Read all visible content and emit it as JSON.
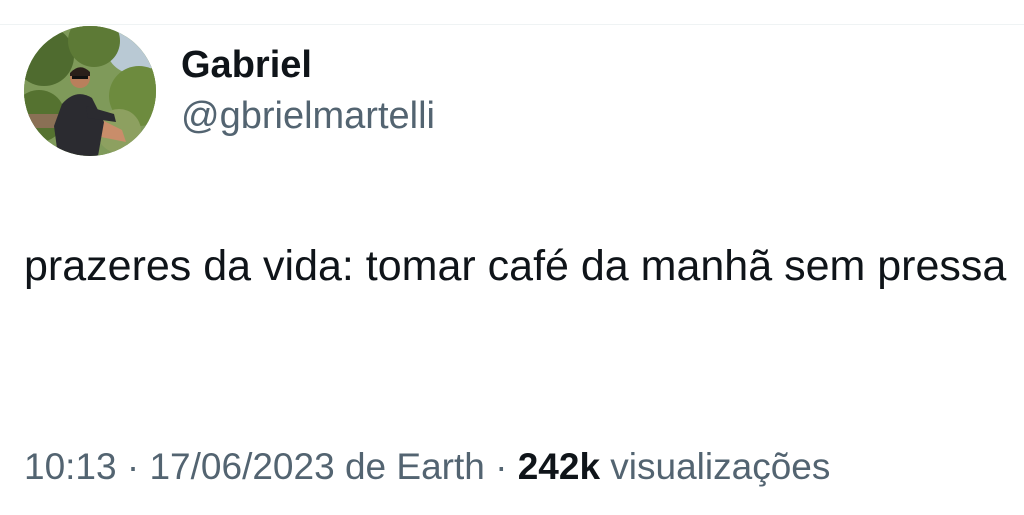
{
  "author": {
    "display_name": "Gabriel",
    "handle": "@gbrielmartelli"
  },
  "tweet": {
    "text": "prazeres da vida: tomar café da manhã sem pressa"
  },
  "meta": {
    "time": "10:13",
    "separator1": " · ",
    "date": "17/06/2023",
    "de": " de ",
    "source": "Earth",
    "separator2": " · ",
    "views_count": "242k",
    "views_label": " visualizações"
  },
  "colors": {
    "text_primary": "#0f1419",
    "text_secondary": "#536471",
    "background": "#ffffff"
  },
  "icons": {
    "avatar": "user-avatar-photo"
  }
}
